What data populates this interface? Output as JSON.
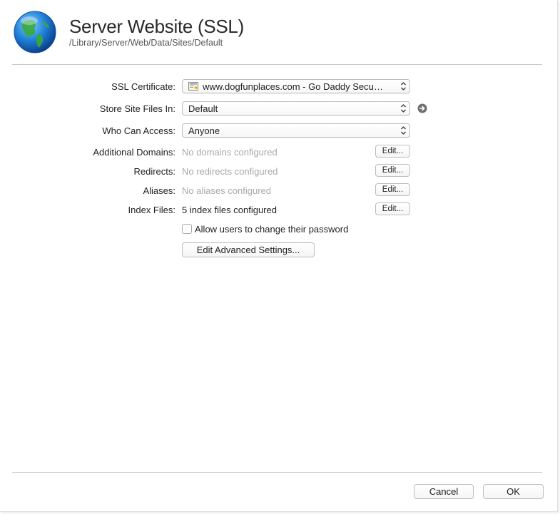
{
  "header": {
    "title": "Server Website (SSL)",
    "path": "/Library/Server/Web/Data/Sites/Default"
  },
  "form": {
    "ssl_certificate": {
      "label": "SSL Certificate:",
      "value": "www.dogfunplaces.com - Go Daddy Secu…",
      "icon": "certificate-icon"
    },
    "store_site_files": {
      "label": "Store Site Files In:",
      "value": "Default",
      "icon": "go-arrow-icon"
    },
    "who_can_access": {
      "label": "Who Can Access:",
      "value": "Anyone"
    },
    "additional_domains": {
      "label": "Additional Domains:",
      "value": "No domains configured",
      "button": "Edit..."
    },
    "redirects": {
      "label": "Redirects:",
      "value": "No redirects configured",
      "button": "Edit..."
    },
    "aliases": {
      "label": "Aliases:",
      "value": "No aliases configured",
      "button": "Edit..."
    },
    "index_files": {
      "label": "Index Files:",
      "value": "5 index files configured",
      "button": "Edit..."
    },
    "allow_password_change": {
      "label": "Allow users to change their password",
      "checked": false
    },
    "advanced_button": "Edit Advanced Settings..."
  },
  "footer": {
    "cancel": "Cancel",
    "ok": "OK"
  },
  "colors": {
    "dim_text": "#a8a8a8",
    "border": "#bdbdbd",
    "separator": "#c9c9c9"
  }
}
